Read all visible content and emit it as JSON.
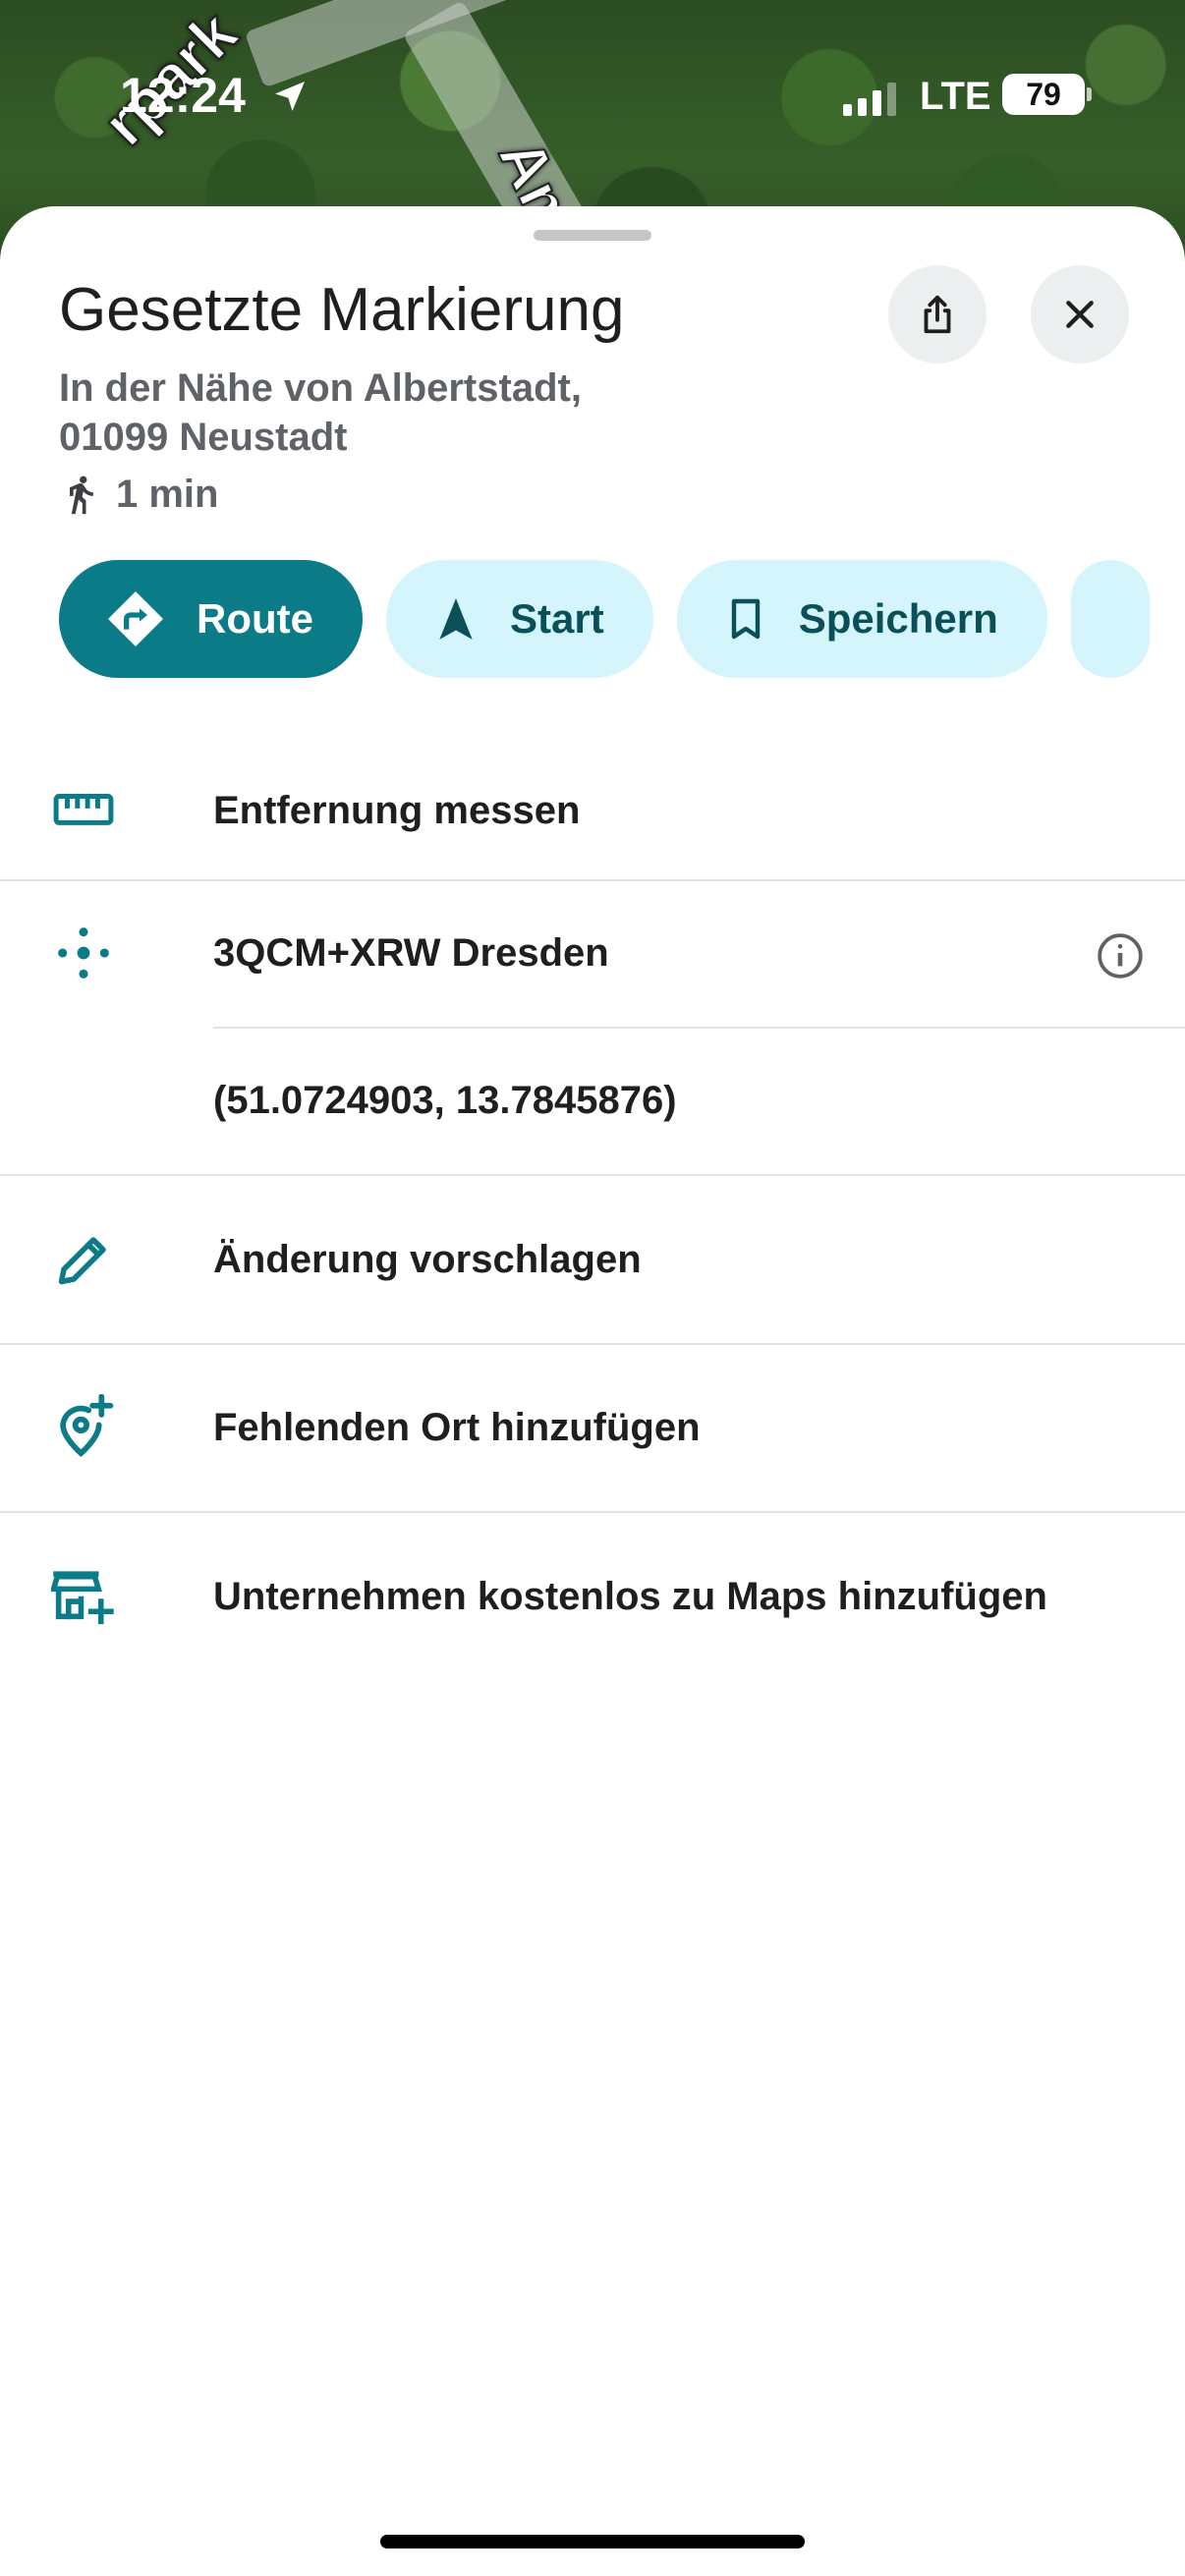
{
  "status_bar": {
    "time": "12:24",
    "network": "LTE",
    "battery": "79"
  },
  "map": {
    "labels": [
      "rpark",
      "Am"
    ]
  },
  "place": {
    "title": "Gesetzte Markierung",
    "address_line1": "In der Nähe von Albertstadt,",
    "address_line2": "01099 Neustadt",
    "walk_time": "1 min"
  },
  "actions": [
    {
      "label": "Route",
      "icon": "directions-icon"
    },
    {
      "label": "Start",
      "icon": "navigation-arrow-icon"
    },
    {
      "label": "Speichern",
      "icon": "bookmark-icon"
    }
  ],
  "list": {
    "measure": "Entfernung messen",
    "plus_code": "3QCM+XRW Dresden",
    "coordinates": "(51.0724903, 13.7845876)",
    "suggest_edit": "Änderung vorschlagen",
    "add_place": "Fehlenden Ort hinzufügen",
    "add_business": "Unternehmen kostenlos zu Maps hinzufügen"
  },
  "colors": {
    "accent": "#0b7b88",
    "chip_bg": "#d3f5fb",
    "chip_text": "#0b4f59"
  }
}
